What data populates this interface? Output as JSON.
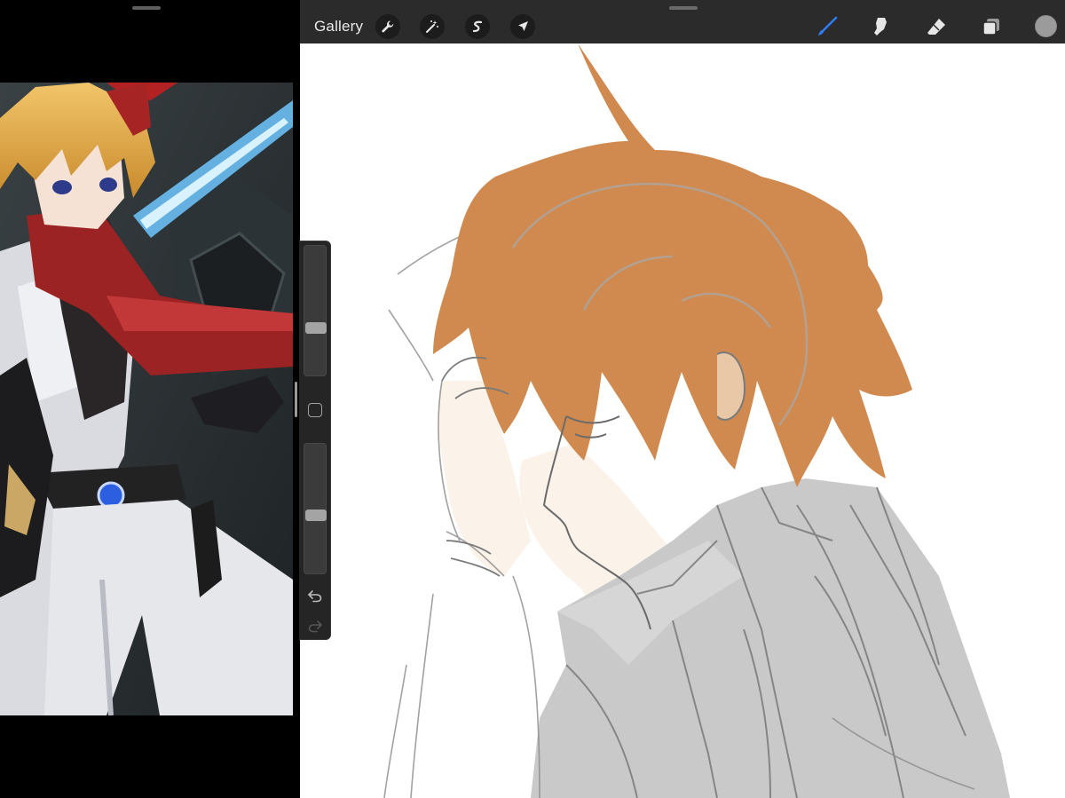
{
  "toolbar": {
    "gallery_label": "Gallery",
    "left_tools": [
      "wrench-icon",
      "magic-wand-icon",
      "selection-icon",
      "transform-arrow-icon"
    ],
    "right_tools": [
      "brush-icon",
      "smudge-icon",
      "eraser-icon",
      "layers-icon"
    ],
    "active_tool": "brush-icon",
    "current_color": "#9b9b9b",
    "accent_color": "#2f7cf6"
  },
  "sidebar": {
    "brush_size_level": 0.36,
    "opacity_level": 0.45,
    "controls": [
      "modify-button",
      "undo-icon",
      "redo-icon"
    ]
  },
  "canvas": {
    "hair_color": "#d08a4f",
    "skin_color": "#fbf2ea",
    "jacket_color": "#c9c9c9"
  },
  "reference": {
    "subject": "anime-character-reference"
  }
}
